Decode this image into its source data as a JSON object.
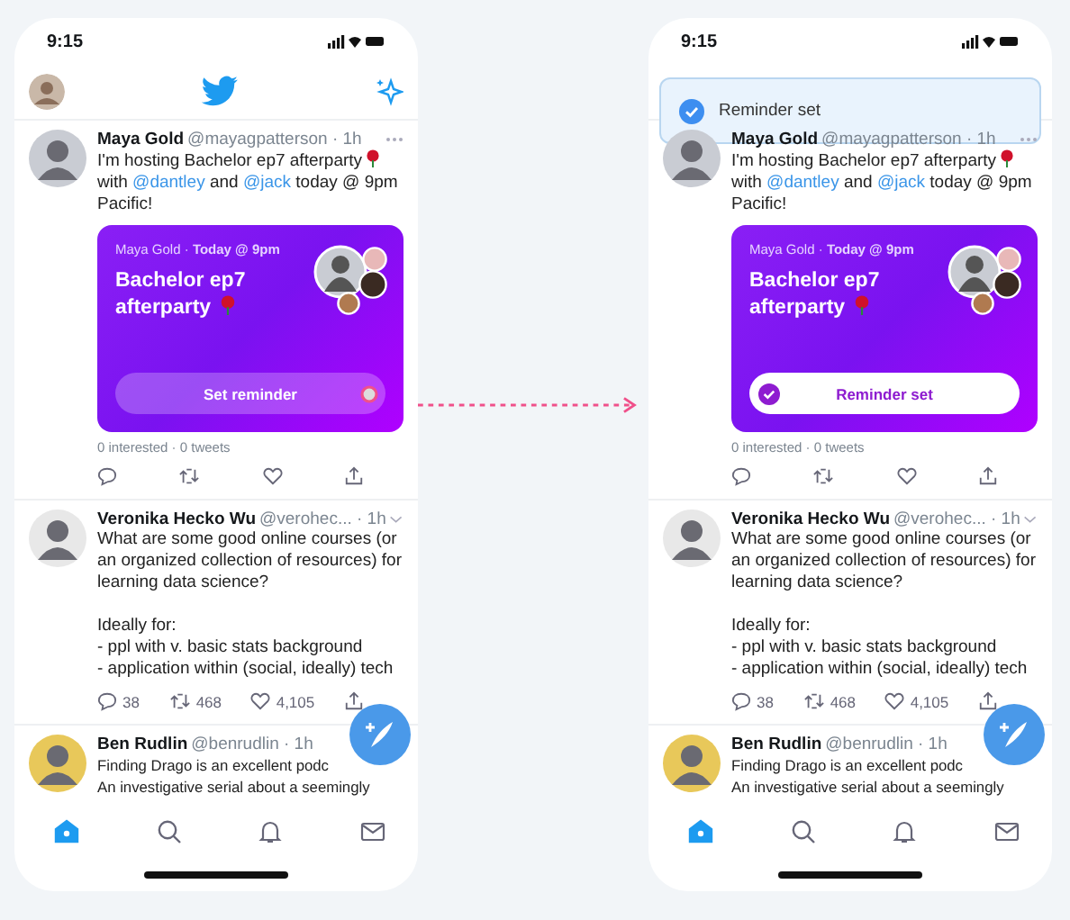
{
  "phones": [
    {
      "time": "9:15",
      "tweets": [
        {
          "name": "Maya Gold",
          "meta": "@mayagpatterson · 1h",
          "more_menu": true,
          "parts": [
            {
              "kind": "text",
              "text": "I'm hosting Bachelor ep7 afterparty"
            },
            {
              "kind": "rose"
            },
            {
              "kind": "text",
              "text": " with "
            },
            {
              "kind": "mention",
              "text": "@dantley"
            },
            {
              "kind": "text",
              "text": " and "
            },
            {
              "kind": "mention",
              "text": "@jack"
            },
            {
              "kind": "text",
              "text": " today @ 9pm Pacific!"
            }
          ],
          "event": {
            "host": "Maya Gold · **Today @ 9pm**",
            "title": "Bachelor ep7 afterparty",
            "button": "Set reminder",
            "reminder_set": false,
            "tapped": true,
            "stats": "0 interested · 0 tweets"
          },
          "actions": true
        },
        {
          "name": "Veronika Hecko Wu",
          "meta": "@verohec... · 1h",
          "caret_menu": true,
          "parts": [
            {
              "kind": "text",
              "text": "What are some good online courses (or an organized collection of resources) for learning data science?\n\nIdeally for:\n- ppl with v. basic stats background\n- application within (social, ideally) tech"
            }
          ],
          "actions": true,
          "counts": {
            "reply": "38",
            "retweet": "468",
            "like": "4,105"
          }
        },
        {
          "name": "Ben Rudlin",
          "meta": "@benrudlin · 1h",
          "parts": [
            {
              "kind": "text",
              "text": "Finding Drago is an excellent podc\nAn investigative serial about a seemingly"
            }
          ]
        }
      ],
      "nav": [
        {
          "kind": "home",
          "selected": true
        },
        {
          "kind": "search",
          "selected": false
        },
        {
          "kind": "bell",
          "selected": false
        },
        {
          "kind": "mail",
          "selected": false
        }
      ]
    },
    {
      "time": "9:15",
      "toast": {
        "text": "Reminder set"
      },
      "tweets": [
        {
          "name": "Maya Gold",
          "meta": "@mayagpatterson · 1h",
          "more_menu": true,
          "parts": [
            {
              "kind": "text",
              "text": "I'm hosting Bachelor ep7 afterparty"
            },
            {
              "kind": "rose"
            },
            {
              "kind": "text",
              "text": " with "
            },
            {
              "kind": "mention",
              "text": "@dantley"
            },
            {
              "kind": "text",
              "text": " and "
            },
            {
              "kind": "mention",
              "text": "@jack"
            },
            {
              "kind": "text",
              "text": " today @ 9pm Pacific!"
            }
          ],
          "event": {
            "host": "Maya Gold · **Today @ 9pm**",
            "title": "Bachelor ep7 afterparty",
            "button": "Reminder set",
            "reminder_set": true,
            "stats": "0 interested · 0 tweets"
          },
          "actions": true
        },
        {
          "name": "Veronika Hecko Wu",
          "meta": "@verohec... · 1h",
          "caret_menu": true,
          "parts": [
            {
              "kind": "text",
              "text": "What are some good online courses (or an organized collection of resources) for learning data science?\n\nIdeally for:\n- ppl with v. basic stats background\n- application within (social, ideally) tech"
            }
          ],
          "actions": true,
          "counts": {
            "reply": "38",
            "retweet": "468",
            "like": "4,105"
          }
        },
        {
          "name": "Ben Rudlin",
          "meta": "@benrudlin · 1h",
          "parts": [
            {
              "kind": "text",
              "text": "Finding Drago is an excellent podc\nAn investigative serial about a seemingly"
            }
          ]
        }
      ],
      "nav": [
        {
          "kind": "home",
          "selected": true
        },
        {
          "kind": "search",
          "selected": false
        },
        {
          "kind": "bell",
          "selected": false
        },
        {
          "kind": "mail",
          "selected": false
        }
      ]
    }
  ]
}
